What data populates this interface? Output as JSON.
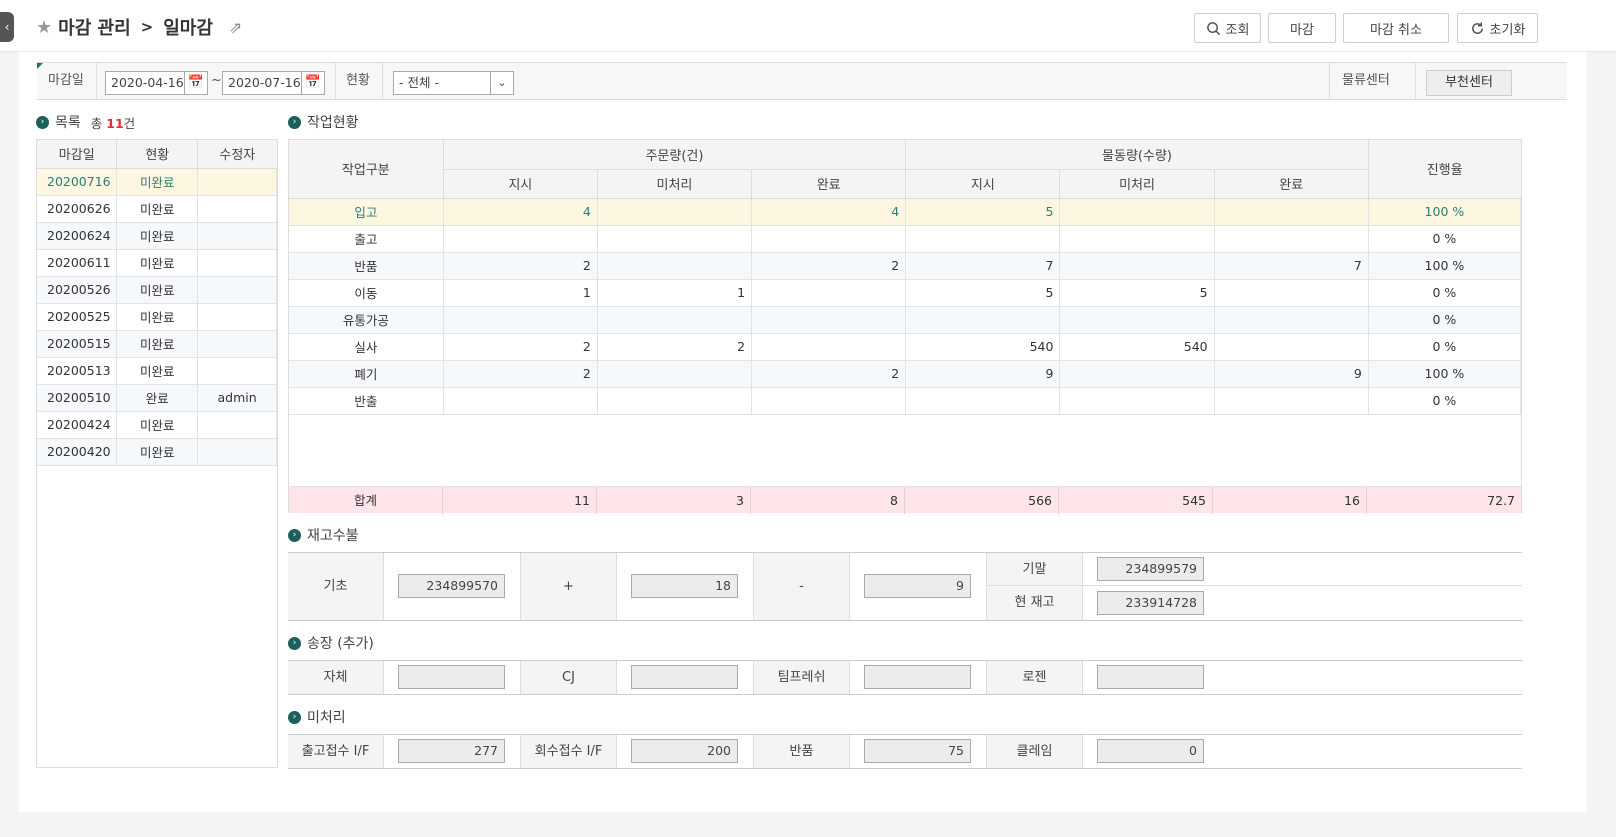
{
  "header": {
    "breadcrumb_parent": "마감 관리",
    "breadcrumb_sep": ">",
    "breadcrumb_current": "일마감",
    "buttons": {
      "search": "조회",
      "close": "마감",
      "cancel_close": "마감 취소",
      "reset": "초기화"
    }
  },
  "filter": {
    "date_label": "마감일",
    "date_from": "2020-04-16",
    "tilde": "~",
    "date_to": "2020-07-16",
    "status_label": "현황",
    "status_value": "- 전체 -",
    "center_label": "물류센터",
    "center_value": "부천센터"
  },
  "list": {
    "title": "목록",
    "total_prefix": "총",
    "total_count": "11",
    "total_suffix": "건",
    "headers": [
      "마감일",
      "현황",
      "수정자"
    ],
    "rows": [
      [
        "20200716",
        "미완료",
        ""
      ],
      [
        "20200626",
        "미완료",
        ""
      ],
      [
        "20200624",
        "미완료",
        ""
      ],
      [
        "20200611",
        "미완료",
        ""
      ],
      [
        "20200526",
        "미완료",
        ""
      ],
      [
        "20200525",
        "미완료",
        ""
      ],
      [
        "20200515",
        "미완료",
        ""
      ],
      [
        "20200513",
        "미완료",
        ""
      ],
      [
        "20200510",
        "완료",
        "admin"
      ],
      [
        "20200424",
        "미완료",
        ""
      ],
      [
        "20200420",
        "미완료",
        ""
      ]
    ]
  },
  "work": {
    "title": "작업현황",
    "h_type": "작업구분",
    "h_order": "주문량(건)",
    "h_qty": "물동량(수량)",
    "h_rate": "진행율",
    "sub": [
      "지시",
      "미처리",
      "완료",
      "지시",
      "미처리",
      "완료"
    ],
    "rows": [
      [
        "입고",
        "4",
        "",
        "4",
        "5",
        "",
        "",
        "100 %"
      ],
      [
        "출고",
        "",
        "",
        "",
        "",
        "",
        "",
        "0 %"
      ],
      [
        "반품",
        "2",
        "",
        "2",
        "7",
        "",
        "7",
        "100 %"
      ],
      [
        "이동",
        "1",
        "1",
        "",
        "5",
        "5",
        "",
        "0 %"
      ],
      [
        "유통가공",
        "",
        "",
        "",
        "",
        "",
        "",
        "0 %"
      ],
      [
        "실사",
        "2",
        "2",
        "",
        "540",
        "540",
        "",
        "0 %"
      ],
      [
        "폐기",
        "2",
        "",
        "2",
        "9",
        "",
        "9",
        "100 %"
      ],
      [
        "반출",
        "",
        "",
        "",
        "",
        "",
        "",
        "0 %"
      ]
    ],
    "total": [
      "합계",
      "11",
      "3",
      "8",
      "566",
      "545",
      "16",
      "72.7"
    ]
  },
  "stock": {
    "title": "재고수불",
    "base_label": "기초",
    "base_value": "234899570",
    "plus": "+",
    "plus_value": "18",
    "minus": "-",
    "minus_value": "9",
    "end_label": "기말",
    "end_value": "234899579",
    "current_label": "현 재고",
    "current_value": "233914728"
  },
  "invoice": {
    "title": "송장 (추가)",
    "labels": [
      "자체",
      "CJ",
      "팀프레쉬",
      "로젠"
    ],
    "values": [
      "",
      "",
      "",
      ""
    ]
  },
  "pending": {
    "title": "미처리",
    "labels": [
      "출고접수 I/F",
      "회수접수 I/F",
      "반품",
      "클레임"
    ],
    "values": [
      "277",
      "200",
      "75",
      "0"
    ]
  }
}
